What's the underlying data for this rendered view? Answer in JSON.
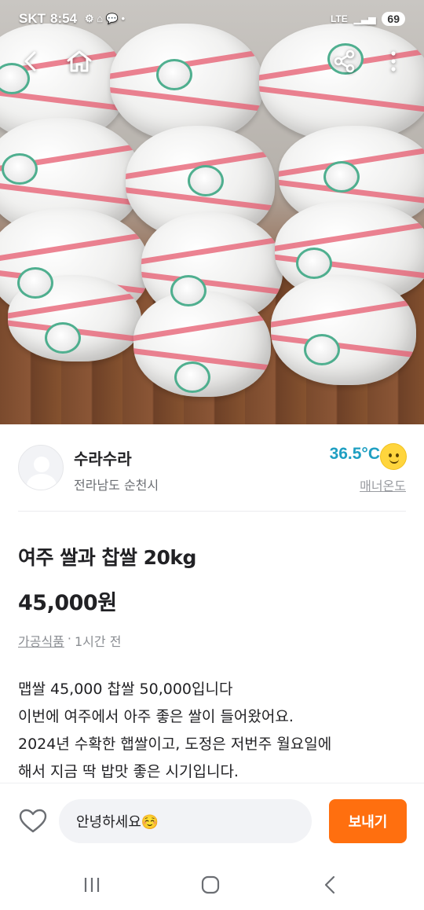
{
  "status_bar": {
    "carrier": "SKT",
    "time": "8:54",
    "network": "LTE",
    "battery": "69"
  },
  "top_nav": {
    "icons": [
      "back-arrow-icon",
      "home-icon",
      "share-icon",
      "more-vertical-icon"
    ]
  },
  "seller": {
    "name": "수라수라",
    "location": "전라남도 순천시",
    "temperature": "36.5°C",
    "manner_label": "매너온도"
  },
  "listing": {
    "title": "여주 쌀과 찹쌀 20kg",
    "price": "45,000원",
    "category": "가공식품",
    "separator": "·",
    "posted": "1시간 전",
    "description_lines": [
      "맵쌀 45,000 찹쌀 50,000입니다",
      "이번에 여주에서 아주 좋은 쌀이 들어왔어요.",
      "2024년 수확한 햅쌀이고, 도정은 저번주 월요일에",
      "해서 지금 딱 밥맛 좋은 시기입니다."
    ]
  },
  "chat": {
    "input_value": "안녕하세요☺️",
    "send_label": "보내기"
  },
  "colors": {
    "accent": "#ff6f0f",
    "temperature": "#1f9fc2",
    "text": "#212124",
    "muted": "#8a8d92"
  }
}
